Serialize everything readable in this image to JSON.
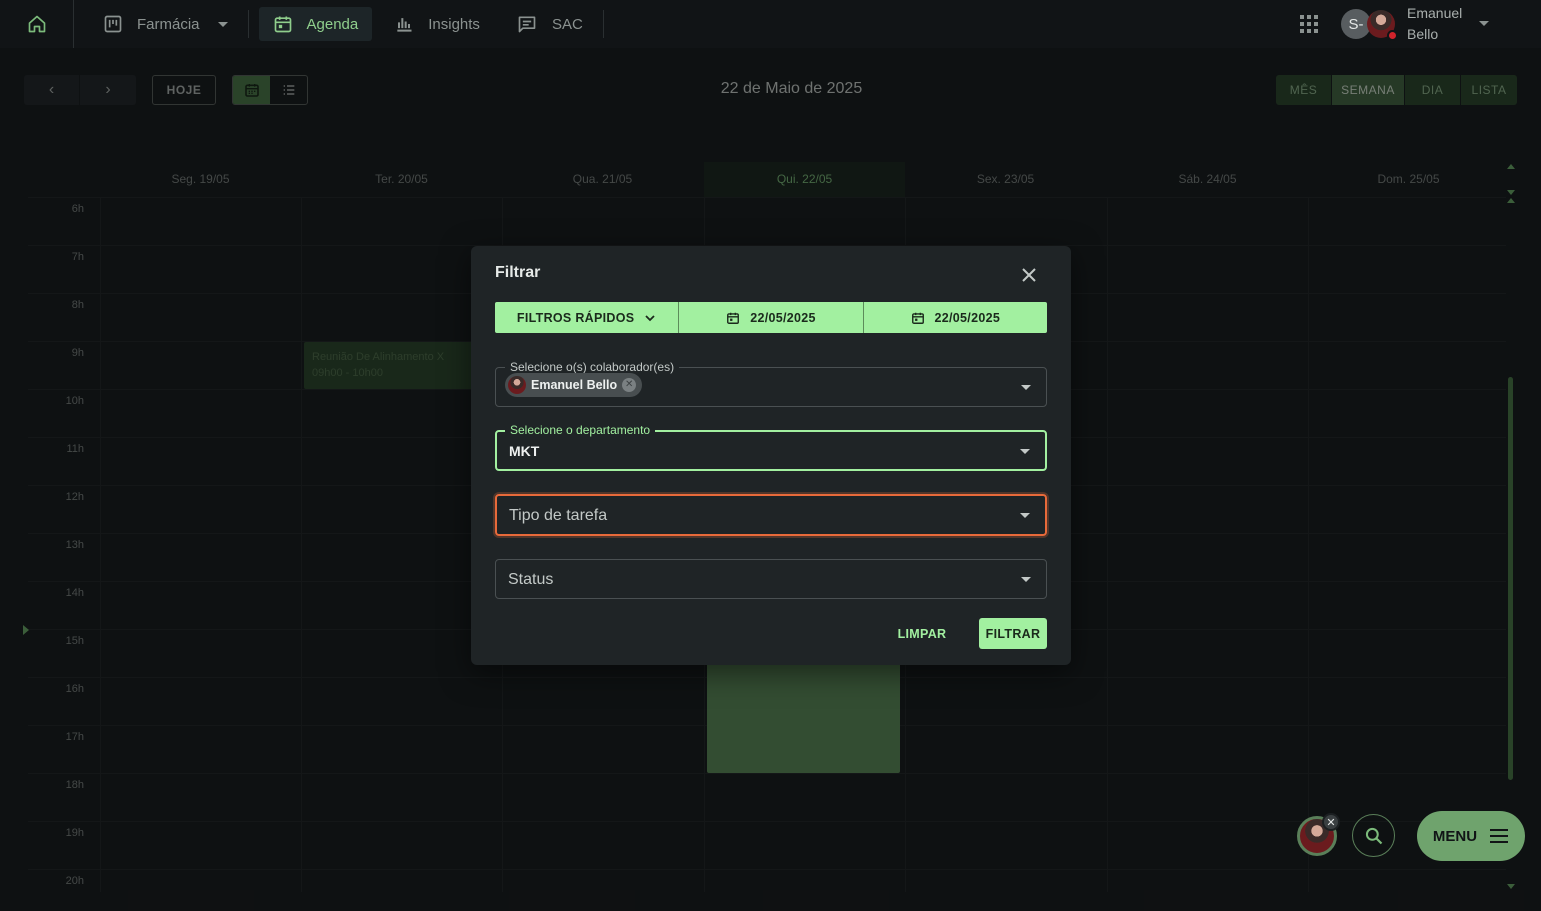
{
  "nav": {
    "items": [
      {
        "label": "Farmácia",
        "icon": "board-icon"
      },
      {
        "label": "Agenda",
        "icon": "calendar-icon"
      },
      {
        "label": "Insights",
        "icon": "chart-icon"
      },
      {
        "label": "SAC",
        "icon": "chat-icon"
      }
    ],
    "user": {
      "initial": "S-",
      "name": "Emanuel Bello"
    }
  },
  "toolbar": {
    "prev": "‹",
    "next": "›",
    "today_label": "HOJE",
    "current_date": "22 de Maio de 2025",
    "ranges": [
      "MÊS",
      "SEMANA",
      "DIA",
      "LISTA"
    ],
    "active_range": "SEMANA"
  },
  "calendar": {
    "days": [
      "Seg. 19/05",
      "Ter. 20/05",
      "Qua. 21/05",
      "Qui. 22/05",
      "Sex. 23/05",
      "Sáb. 24/05",
      "Dom. 25/05"
    ],
    "today_index": 3,
    "hours": [
      "6h",
      "7h",
      "8h",
      "9h",
      "10h",
      "11h",
      "12h",
      "13h",
      "14h",
      "15h",
      "16h",
      "17h",
      "18h",
      "19h",
      "20h"
    ],
    "events": [
      {
        "title": "Reunião De Alinhamento X",
        "time": "09h00 - 10h00"
      }
    ]
  },
  "modal": {
    "title": "Filtrar",
    "quick_filters_label": "FILTROS RÁPIDOS",
    "date_start": "22/05/2025",
    "date_end": "22/05/2025",
    "collaborators": {
      "legend": "Selecione o(s) colaborador(es)",
      "selected": [
        "Emanuel Bello"
      ]
    },
    "department": {
      "legend": "Selecione o departamento",
      "value": "MKT"
    },
    "task_type": {
      "placeholder": "Tipo de tarefa"
    },
    "status": {
      "placeholder": "Status"
    },
    "clear_label": "LIMPAR",
    "filter_label": "FILTRAR"
  },
  "fab": {
    "menu_label": "MENU"
  },
  "colors": {
    "accent": "#a2f0a0",
    "accent_dark": "#4d7a4b",
    "error": "#e86a3a",
    "background": "#1b1f21"
  }
}
